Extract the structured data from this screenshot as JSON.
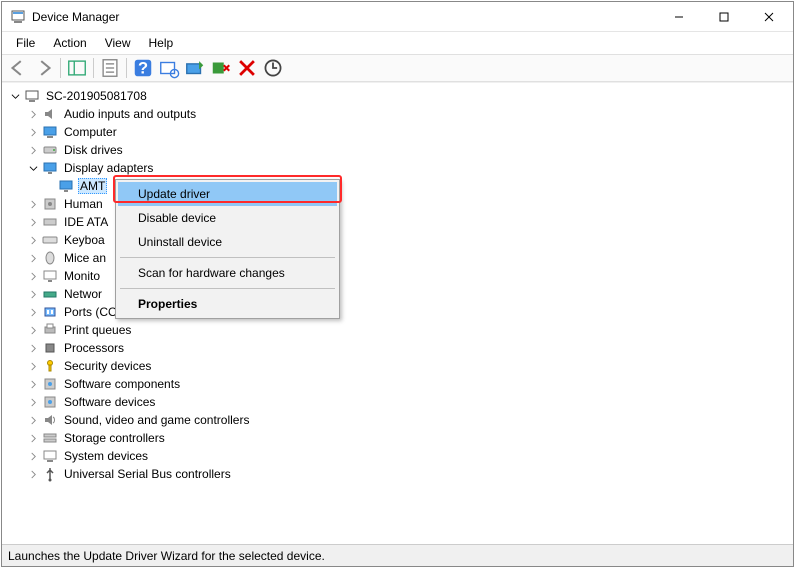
{
  "window": {
    "title": "Device Manager"
  },
  "menu": {
    "file": "File",
    "action": "Action",
    "view": "View",
    "help": "Help"
  },
  "tree": {
    "root": "SC-201905081708",
    "items": [
      "Audio inputs and outputs",
      "Computer",
      "Disk drives",
      "Display adapters",
      "Human Interface Devices",
      "IDE ATA/ATAPI controllers",
      "Keyboards",
      "Mice and other pointing devices",
      "Monitors",
      "Network adapters",
      "Ports (COM & LPT)",
      "Print queues",
      "Processors",
      "Security devices",
      "Software components",
      "Software devices",
      "Sound, video and game controllers",
      "Storage controllers",
      "System devices",
      "Universal Serial Bus controllers"
    ],
    "items_truncated": [
      "Audio inputs and outputs",
      "Computer",
      "Disk drives",
      "Display adapters",
      "Human",
      "IDE ATA",
      "Keyboa",
      "Mice an",
      "Monito",
      "Networ",
      "Ports (COM & LPT)",
      "Print queues",
      "Processors",
      "Security devices",
      "Software components",
      "Software devices",
      "Sound, video and game controllers",
      "Storage controllers",
      "System devices",
      "Universal Serial Bus controllers"
    ],
    "display_child": "AMT",
    "display_child_full": "AMT"
  },
  "context_menu": {
    "update": "Update driver",
    "disable": "Disable device",
    "uninstall": "Uninstall device",
    "scan": "Scan for hardware changes",
    "properties": "Properties"
  },
  "status": "Launches the Update Driver Wizard for the selected device."
}
